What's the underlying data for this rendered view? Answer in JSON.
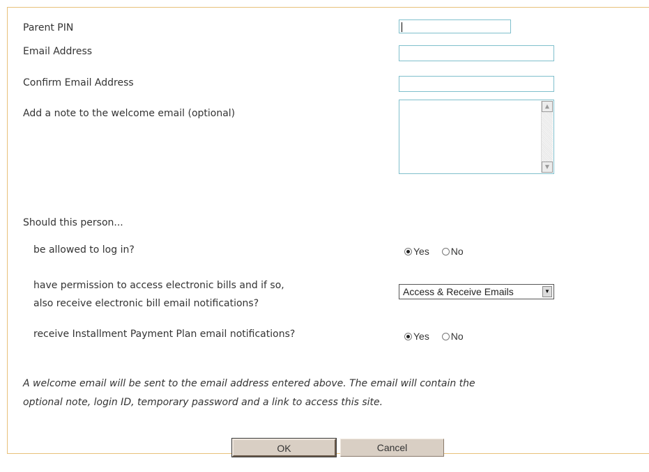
{
  "form": {
    "parent_pin_label": "Parent PIN",
    "parent_pin_value": "",
    "email_label": "Email Address",
    "email_value": "",
    "confirm_email_label": "Confirm Email Address",
    "confirm_email_value": "",
    "note_label": "Add a note to the welcome email (optional)",
    "note_value": ""
  },
  "permissions": {
    "heading": "Should this person...",
    "login": {
      "question": "be allowed to log in?",
      "yes_label": "Yes",
      "no_label": "No",
      "selected": "Yes"
    },
    "ebills": {
      "question_line1": "have permission to access electronic bills and if so,",
      "question_line2": "also receive electronic bill email notifications?",
      "selected_option": "Access & Receive Emails"
    },
    "installment": {
      "question": "receive Installment Payment Plan email notifications?",
      "yes_label": "Yes",
      "no_label": "No",
      "selected": "Yes"
    }
  },
  "footer": {
    "note": "A welcome email will be sent to the email address entered above. The email will contain the optional note, login ID, temporary password and a link to access this site.",
    "ok_label": "OK",
    "cancel_label": "Cancel"
  }
}
